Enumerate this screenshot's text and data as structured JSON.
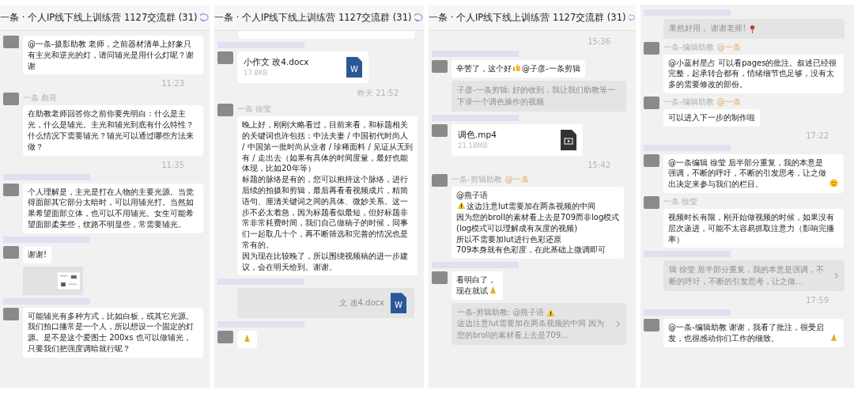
{
  "panels": [
    {
      "title": "一条 · 个人IP线下线上训练营 1127交流群 (31)",
      "items": [
        {
          "kind": "message",
          "paragraphs": [
            [
              {
                "kind": "text",
                "text": "@一条-摄影助教 老师，之前器材清单上好象只有主光和逆光的灯，请问辅光是用什么灯呢？谢谢"
              }
            ]
          ]
        },
        {
          "kind": "time",
          "text": "11:23"
        },
        {
          "kind": "message",
          "sender": "一条 彪哥",
          "paragraphs": [
            [
              {
                "kind": "text",
                "text": "在助教老师回答你之前你要先明白：什么是主光，什么是辅光。主光和辅光到底有什么特性？什么情况下需要辅光？辅光可以通过哪些方法来做？"
              }
            ]
          ]
        },
        {
          "kind": "time",
          "text": "11:35"
        },
        {
          "kind": "mask"
        },
        {
          "kind": "message",
          "paragraphs": [
            [
              {
                "kind": "text",
                "text": "个人理解是，主光是打在人物的主要光源。当觉得面部其它部分太暗时，可以用辅光打。当然如果希望面部立体，也可以不用辅光。女生可能希望面部柔美些，纹路不明显些，常需要辅光。"
              }
            ]
          ]
        },
        {
          "kind": "mask"
        },
        {
          "kind": "message",
          "paragraphs": [
            [
              {
                "kind": "text",
                "text": "谢谢!"
              }
            ]
          ]
        },
        {
          "kind": "image"
        },
        {
          "kind": "mask"
        },
        {
          "kind": "message",
          "paragraphs": [
            [
              {
                "kind": "text",
                "text": "可能辅光有多种方式，比如白板，或其它光源。我们拍口播常是一个人，所以想设一个固定的灯源。是不是这个爱图士 200xs 也可以做辅光，只要我们把强度调暗就行呢？"
              }
            ]
          ]
        }
      ]
    },
    {
      "title": "一条 · 个人IP线下线上训练营 1127交流群 (31)",
      "items": [
        {
          "kind": "cut"
        },
        {
          "kind": "mask"
        },
        {
          "kind": "doc",
          "badge": "W",
          "file_name": "小作文 改4.docx",
          "size": "17.8KB"
        },
        {
          "kind": "time",
          "text": "昨天 21:52"
        },
        {
          "kind": "message",
          "sender": "一条 徐莹",
          "paragraphs": [
            [
              {
                "kind": "text",
                "text": "晚上好，刚刚大略看过，目前来看，和标题相关的关键词也许包括：中法夫妻 / 中国初代时尚人 / 中国第一批时尚从业者 / 珍稀面料 / 见证从无到有 / 走出去（如果有具体的时间度量，最好也能体现，比如20年等）"
              }
            ],
            [
              {
                "kind": "text",
                "text": "标题的脉络是有的，您可以抱持这个脉络，进行后续的拍摄和剪辑，最后再看看视频成片，精简语句、厘清关键词之间的具体、微妙关系。这一步不必太着急，因为标题看似最短，但好标题非常非常耗费时间，我们自己做稿子的时候，同事们一起取几十个，再不断筛选和完善的情况也是常有的。"
              }
            ],
            [
              {
                "kind": "text",
                "text": "因为现在比较晚了，所以围绕视频稿的进一步建议，会在明天给到。谢谢。"
              }
            ]
          ]
        },
        {
          "kind": "mask"
        },
        {
          "kind": "quote-doc",
          "badge": "W",
          "file_name": "文 改4.docx"
        },
        {
          "kind": "mask"
        },
        {
          "kind": "message",
          "paragraphs": [
            [
              {
                "kind": "pray"
              }
            ]
          ]
        }
      ]
    },
    {
      "title": "一条 · 个人IP线下线上训练营 1127交流群 (31)",
      "items": [
        {
          "kind": "time",
          "text": "15:36"
        },
        {
          "kind": "mask"
        },
        {
          "kind": "message",
          "paragraphs": [
            [
              {
                "kind": "text",
                "text": "辛苦了，这个好"
              },
              {
                "kind": "thumb"
              },
              {
                "kind": "text",
                "text": "@子彦-一条剪辑"
              }
            ]
          ]
        },
        {
          "kind": "quote",
          "more": false,
          "parts": [
            {
              "kind": "text",
              "text": "子彦-一条剪辑: 好的收到，我让我们助教等一下录一个调色操作的视频"
            }
          ]
        },
        {
          "kind": "mask"
        },
        {
          "kind": "video",
          "file_name": "调色.mp4",
          "size": "21.18MB"
        },
        {
          "kind": "time",
          "text": "15:42"
        },
        {
          "kind": "message",
          "sender": "一条-剪辑助教",
          "sender_tag": "@一条",
          "paragraphs": [
            [
              {
                "kind": "text",
                "text": "@燕子语"
              }
            ],
            [
              {
                "kind": "warning"
              },
              {
                "kind": "text",
                "text": "这边注意lut需要加在两条视频的中间"
              }
            ],
            [
              {
                "kind": "text",
                "text": "因为您的broll的素材看上去是709而非log模式"
              }
            ],
            [
              {
                "kind": "text",
                "text": "(log模式可以理解成有灰度的视频)"
              }
            ],
            [
              {
                "kind": "text",
                "text": "所以不需要加lut进行色彩还原"
              }
            ],
            [
              {
                "kind": "text",
                "text": "709本身就有色彩度，在此基础上微调即可"
              }
            ]
          ]
        },
        {
          "kind": "mask"
        },
        {
          "kind": "message",
          "paragraphs": [
            [
              {
                "kind": "text",
                "text": "看明白了，"
              }
            ],
            [
              {
                "kind": "text",
                "text": "现在就试"
              },
              {
                "kind": "pray"
              }
            ]
          ]
        },
        {
          "kind": "quote",
          "more": true,
          "parts": [
            {
              "kind": "text",
              "text": "一条-剪辑助教: @燕子语"
            },
            {
              "kind": "warning"
            },
            {
              "kind": "text",
              "text": "这边注意lut需要加在两条视频的中间 因为您的broll的素材看上去是709..."
            }
          ]
        }
      ]
    },
    {
      "items": [
        {
          "kind": "mask"
        },
        {
          "kind": "quote",
          "more": false,
          "parts": [
            {
              "kind": "text",
              "text": "果然好用， 谢谢老师!"
            },
            {
              "kind": "rose"
            }
          ]
        },
        {
          "kind": "message",
          "sender": "一条-编辑助教",
          "sender_tag": "@一条",
          "paragraphs": [
            [
              {
                "kind": "text",
                "text": "@小蓝村星占 可以看pages的批注。叙述已经很完整，起承转合都有，情绪细节也足够，没有太多的需要修改的部份。"
              }
            ]
          ]
        },
        {
          "kind": "message",
          "sender": "一条-编辑助教",
          "sender_tag": "@一条",
          "paragraphs": [
            [
              {
                "kind": "text",
                "text": "可以进入下一步的制作啦"
              }
            ]
          ]
        },
        {
          "kind": "time",
          "text": "17:22"
        },
        {
          "kind": "mask"
        },
        {
          "kind": "message",
          "paragraphs": [
            [
              {
                "kind": "text",
                "text": "@一条编辑 徐莹 后半部分重复，我的本意是强调，不断的呼吁，不断的引发思考，让之做出决定来参与我们的栏目。"
              },
              {
                "kind": "face"
              }
            ]
          ]
        },
        {
          "kind": "message",
          "sender": "一条 徐莹",
          "paragraphs": [
            [
              {
                "kind": "text",
                "text": "视频时长有限，刚开始做视频的时候，如果没有层次递进，可能不太容易抓取注意力（影响完播率）"
              }
            ]
          ]
        },
        {
          "kind": "mask"
        },
        {
          "kind": "quote",
          "more": true,
          "parts": [
            {
              "kind": "text",
              "text": "辑 徐莹 后半部分重复，我的本意是强调，不断的呼吁，不断的引发思考，让之做..."
            }
          ]
        },
        {
          "kind": "time",
          "text": "17:59"
        },
        {
          "kind": "mask"
        },
        {
          "kind": "message",
          "paragraphs": [
            [
              {
                "kind": "text",
                "text": "@一条-编辑助教 谢谢，我看了批注，很受启发，也很感动你们工作的细致。"
              },
              {
                "kind": "pray"
              }
            ]
          ]
        }
      ]
    }
  ]
}
